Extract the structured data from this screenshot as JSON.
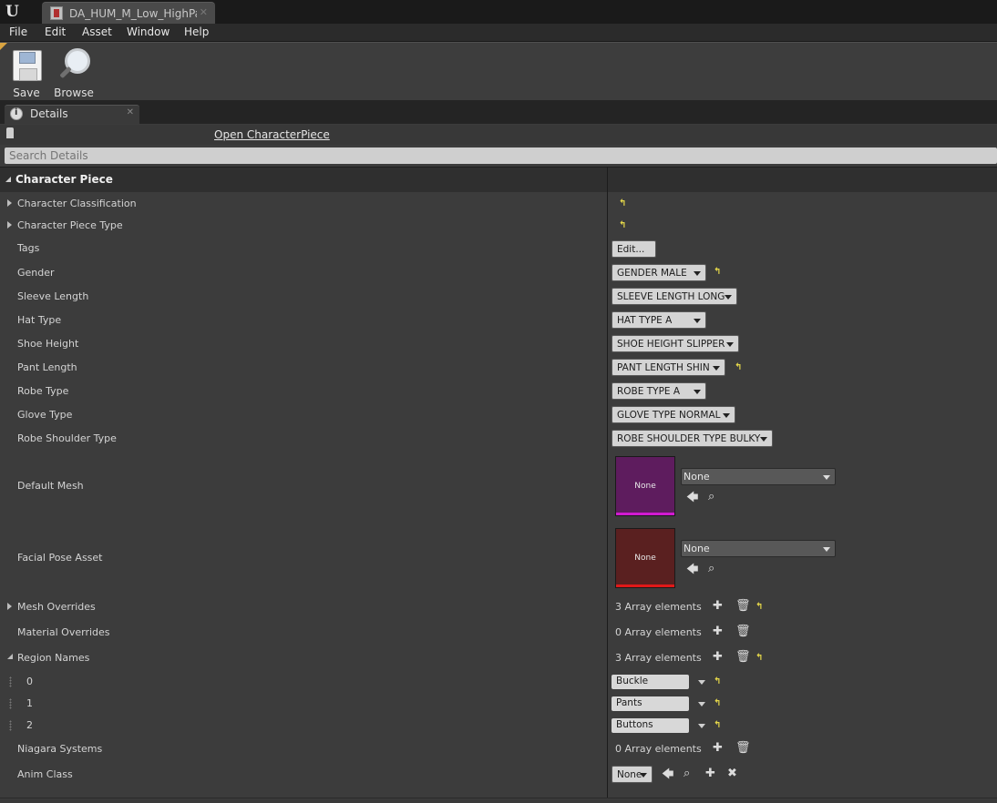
{
  "window": {
    "tab_title": "DA_HUM_M_Low_HighPar"
  },
  "menu": [
    "File",
    "Edit",
    "Asset",
    "Window",
    "Help"
  ],
  "toolbar": {
    "save_label": "Save",
    "browse_label": "Browse"
  },
  "details_tab": {
    "label": "Details"
  },
  "object": {
    "open_link": "Open CharacterPiece"
  },
  "search": {
    "placeholder": "Search Details"
  },
  "category": {
    "title": "Character Piece"
  },
  "rows": {
    "character_classification": "Character Classification",
    "character_piece_type": "Character Piece Type",
    "tags": {
      "label": "Tags",
      "button": "Edit..."
    },
    "gender": {
      "label": "Gender",
      "value": "GENDER MALE"
    },
    "sleeve_length": {
      "label": "Sleeve Length",
      "value": "SLEEVE LENGTH LONG"
    },
    "hat_type": {
      "label": "Hat Type",
      "value": "HAT TYPE A"
    },
    "shoe_height": {
      "label": "Shoe Height",
      "value": "SHOE HEIGHT SLIPPER"
    },
    "pant_length": {
      "label": "Pant Length",
      "value": "PANT LENGTH SHIN"
    },
    "robe_type": {
      "label": "Robe Type",
      "value": "ROBE TYPE A"
    },
    "glove_type": {
      "label": "Glove Type",
      "value": "GLOVE TYPE NORMAL"
    },
    "robe_shoulder_type": {
      "label": "Robe Shoulder Type",
      "value": "ROBE SHOULDER TYPE BULKY"
    },
    "default_mesh": {
      "label": "Default Mesh",
      "thumb": "None",
      "value": "None",
      "thumb_color": "#5e1c5e",
      "bar_color": "#d01ad0"
    },
    "facial_pose_asset": {
      "label": "Facial Pose Asset",
      "thumb": "None",
      "value": "None",
      "thumb_color": "#5a2020",
      "bar_color": "#e01818"
    },
    "mesh_overrides": {
      "label": "Mesh Overrides",
      "value": "3 Array elements"
    },
    "material_overrides": {
      "label": "Material Overrides",
      "value": "0 Array elements"
    },
    "region_names": {
      "label": "Region Names",
      "value": "3 Array elements",
      "items": [
        {
          "index": "0",
          "value": "Buckle"
        },
        {
          "index": "1",
          "value": "Pants"
        },
        {
          "index": "2",
          "value": "Buttons"
        }
      ]
    },
    "niagara_systems": {
      "label": "Niagara Systems",
      "value": "0 Array elements"
    },
    "anim_class": {
      "label": "Anim Class",
      "value": "None"
    }
  },
  "icons": {
    "reset": "reset-to-default-icon",
    "add": "plus-icon",
    "delete": "trash-icon",
    "use": "arrow-left-icon",
    "browse": "magnifier-icon",
    "clear": "x-icon"
  },
  "colors": {
    "reset_arrow": "#e6d84a",
    "panel_bg": "#3c3c3c",
    "combo_bg": "#d4d4d4"
  }
}
